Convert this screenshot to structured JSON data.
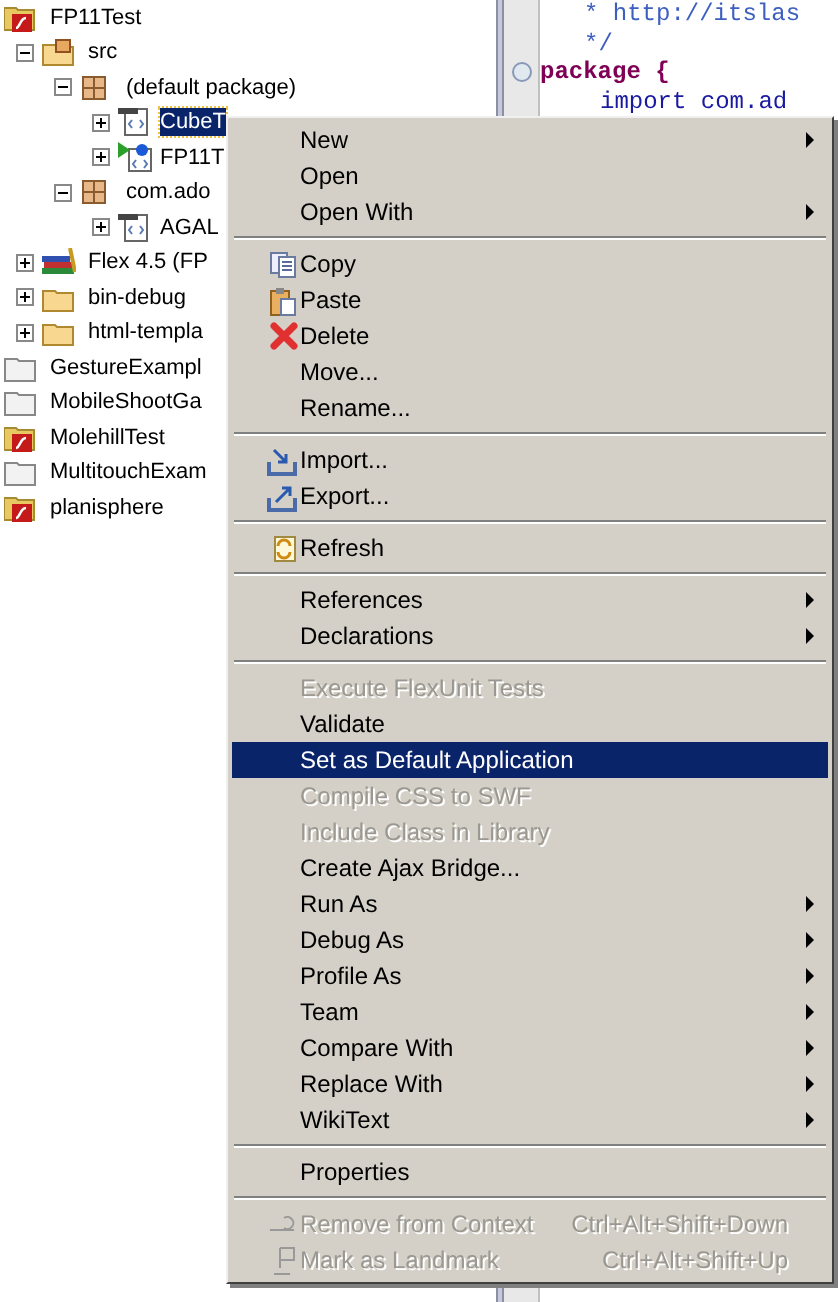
{
  "tree": [
    {
      "label": "FP11Test",
      "kind": "flex-project",
      "children": [
        {
          "label": "src",
          "kind": "source-folder",
          "expanded": true,
          "children": [
            {
              "label": "(default package)",
              "kind": "package",
              "expanded": true,
              "children": [
                {
                  "label": "CubeT",
                  "kind": "file",
                  "selected": true,
                  "expanded": false
                },
                {
                  "label": "FP11T",
                  "kind": "app-file",
                  "selected": false,
                  "expanded": false
                }
              ]
            },
            {
              "label": "com.ado",
              "kind": "package",
              "expanded": true,
              "children": [
                {
                  "label": "AGAL",
                  "kind": "file",
                  "selected": false,
                  "expanded": false
                }
              ]
            }
          ]
        },
        {
          "label": "Flex 4.5 (FP",
          "kind": "library",
          "expanded": false
        },
        {
          "label": "bin-debug",
          "kind": "folder",
          "expanded": false
        },
        {
          "label": "html-templa",
          "kind": "folder",
          "expanded": false
        }
      ]
    },
    {
      "label": "GestureExampl",
      "kind": "project"
    },
    {
      "label": "MobileShootGa",
      "kind": "project"
    },
    {
      "label": "MolehillTest",
      "kind": "flex-project"
    },
    {
      "label": "MultitouchExam",
      "kind": "project"
    },
    {
      "label": "planisphere",
      "kind": "flex-project"
    }
  ],
  "editor": {
    "lines": [
      {
        "kind": "comment",
        "text": "* http://itslas"
      },
      {
        "kind": "comment",
        "text": "*/"
      },
      {
        "kind": "package",
        "text": "package {"
      },
      {
        "kind": "import",
        "text": "import com.ad"
      }
    ]
  },
  "menu": [
    {
      "kind": "item",
      "label": "New",
      "submenu": true,
      "disabled": false,
      "selected": false
    },
    {
      "kind": "item",
      "label": "Open",
      "submenu": false,
      "disabled": false,
      "selected": false
    },
    {
      "kind": "item",
      "label": "Open With",
      "submenu": true,
      "disabled": false,
      "selected": false
    },
    {
      "kind": "separator"
    },
    {
      "kind": "item",
      "label": "Copy",
      "submenu": false,
      "disabled": false,
      "selected": false
    },
    {
      "kind": "item",
      "label": "Paste",
      "submenu": false,
      "disabled": false,
      "selected": false
    },
    {
      "kind": "item",
      "label": "Delete",
      "submenu": false,
      "disabled": false,
      "selected": false
    },
    {
      "kind": "item",
      "label": "Move...",
      "submenu": false,
      "disabled": false,
      "selected": false
    },
    {
      "kind": "item",
      "label": "Rename...",
      "submenu": false,
      "disabled": false,
      "selected": false
    },
    {
      "kind": "separator"
    },
    {
      "kind": "item",
      "label": "Import...",
      "submenu": false,
      "disabled": false,
      "selected": false
    },
    {
      "kind": "item",
      "label": "Export...",
      "submenu": false,
      "disabled": false,
      "selected": false
    },
    {
      "kind": "separator"
    },
    {
      "kind": "item",
      "label": "Refresh",
      "submenu": false,
      "disabled": false,
      "selected": false
    },
    {
      "kind": "separator"
    },
    {
      "kind": "item",
      "label": "References",
      "submenu": true,
      "disabled": false,
      "selected": false
    },
    {
      "kind": "item",
      "label": "Declarations",
      "submenu": true,
      "disabled": false,
      "selected": false
    },
    {
      "kind": "separator"
    },
    {
      "kind": "item",
      "label": "Execute FlexUnit Tests",
      "submenu": false,
      "disabled": true,
      "selected": false
    },
    {
      "kind": "item",
      "label": "Validate",
      "submenu": false,
      "disabled": false,
      "selected": false
    },
    {
      "kind": "item",
      "label": "Set as Default Application",
      "submenu": false,
      "disabled": false,
      "selected": true
    },
    {
      "kind": "item",
      "label": "Compile CSS to SWF",
      "submenu": false,
      "disabled": true,
      "selected": false
    },
    {
      "kind": "item",
      "label": "Include Class in Library",
      "submenu": false,
      "disabled": true,
      "selected": false
    },
    {
      "kind": "item",
      "label": "Create Ajax Bridge...",
      "submenu": false,
      "disabled": false,
      "selected": false
    },
    {
      "kind": "item",
      "label": "Run As",
      "submenu": true,
      "disabled": false,
      "selected": false
    },
    {
      "kind": "item",
      "label": "Debug As",
      "submenu": true,
      "disabled": false,
      "selected": false
    },
    {
      "kind": "item",
      "label": "Profile As",
      "submenu": true,
      "disabled": false,
      "selected": false
    },
    {
      "kind": "item",
      "label": "Team",
      "submenu": true,
      "disabled": false,
      "selected": false
    },
    {
      "kind": "item",
      "label": "Compare With",
      "submenu": true,
      "disabled": false,
      "selected": false
    },
    {
      "kind": "item",
      "label": "Replace With",
      "submenu": true,
      "disabled": false,
      "selected": false
    },
    {
      "kind": "item",
      "label": "WikiText",
      "submenu": true,
      "disabled": false,
      "selected": false
    },
    {
      "kind": "separator"
    },
    {
      "kind": "item",
      "label": "Properties",
      "submenu": false,
      "disabled": false,
      "selected": false
    },
    {
      "kind": "separator"
    },
    {
      "kind": "item",
      "label": "Remove from Context",
      "shortcut": "Ctrl+Alt+Shift+Down",
      "submenu": false,
      "disabled": true,
      "selected": false
    },
    {
      "kind": "item",
      "label": "Mark as Landmark",
      "shortcut": "Ctrl+Alt+Shift+Up",
      "submenu": false,
      "disabled": true,
      "selected": false
    }
  ]
}
